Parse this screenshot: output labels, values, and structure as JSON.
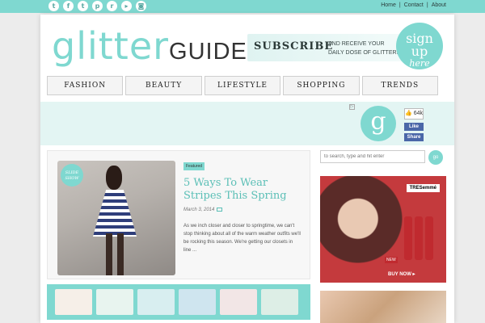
{
  "topbar": {
    "social_icons": [
      "twitter-icon",
      "facebook-icon",
      "tumblr-icon",
      "pinterest-icon",
      "rss-icon",
      "video-icon",
      "instagram-icon"
    ],
    "social_glyphs": [
      "t",
      "f",
      "t",
      "p",
      "r",
      "▸",
      "◙"
    ],
    "nav": [
      "Home",
      "Contact",
      "About"
    ],
    "separator": "|"
  },
  "header": {
    "logo_part1": "glitter",
    "logo_part2": "GUIDE",
    "subscribe_label": "SUBSCRIBE",
    "subscribe_tagline_l1": "AND RECEIVE YOUR",
    "subscribe_tagline_l2": "DAILY DOSE OF GLITTER!",
    "signup_l1": "sign up",
    "signup_l2": "here"
  },
  "main_nav": [
    "FASHION",
    "BEAUTY",
    "LIFESTYLE",
    "SHOPPING",
    "TRENDS"
  ],
  "banner": {
    "logo_glyph": "g",
    "like_count": "64k",
    "like_label": "Like",
    "share_label": "Share"
  },
  "post": {
    "badge": "SLIDE SHOW",
    "featured_tag": "Featured",
    "title": "5 Ways To Wear Stripes This Spring",
    "date": "March 3, 2014",
    "excerpt": "As we inch closer and closer to springtime, we can't stop thinking about all of the warm weather outfits we'll be rocking this season. We're getting our closets in line ..."
  },
  "thumbnails": [
    "#f6efe8",
    "#e8f4ef",
    "#d8eef0",
    "#cfe5ef",
    "#f2e6e6",
    "#ddeee6"
  ],
  "sidebar": {
    "search_placeholder": "to search, type and hit enter",
    "search_button": "go",
    "ad_brand": "TRESemmé",
    "ad_new": "NEW",
    "ad_cta": "BUY NOW ▸"
  },
  "colors": {
    "accent": "#7fd8d0",
    "nav_text": "#222222"
  }
}
